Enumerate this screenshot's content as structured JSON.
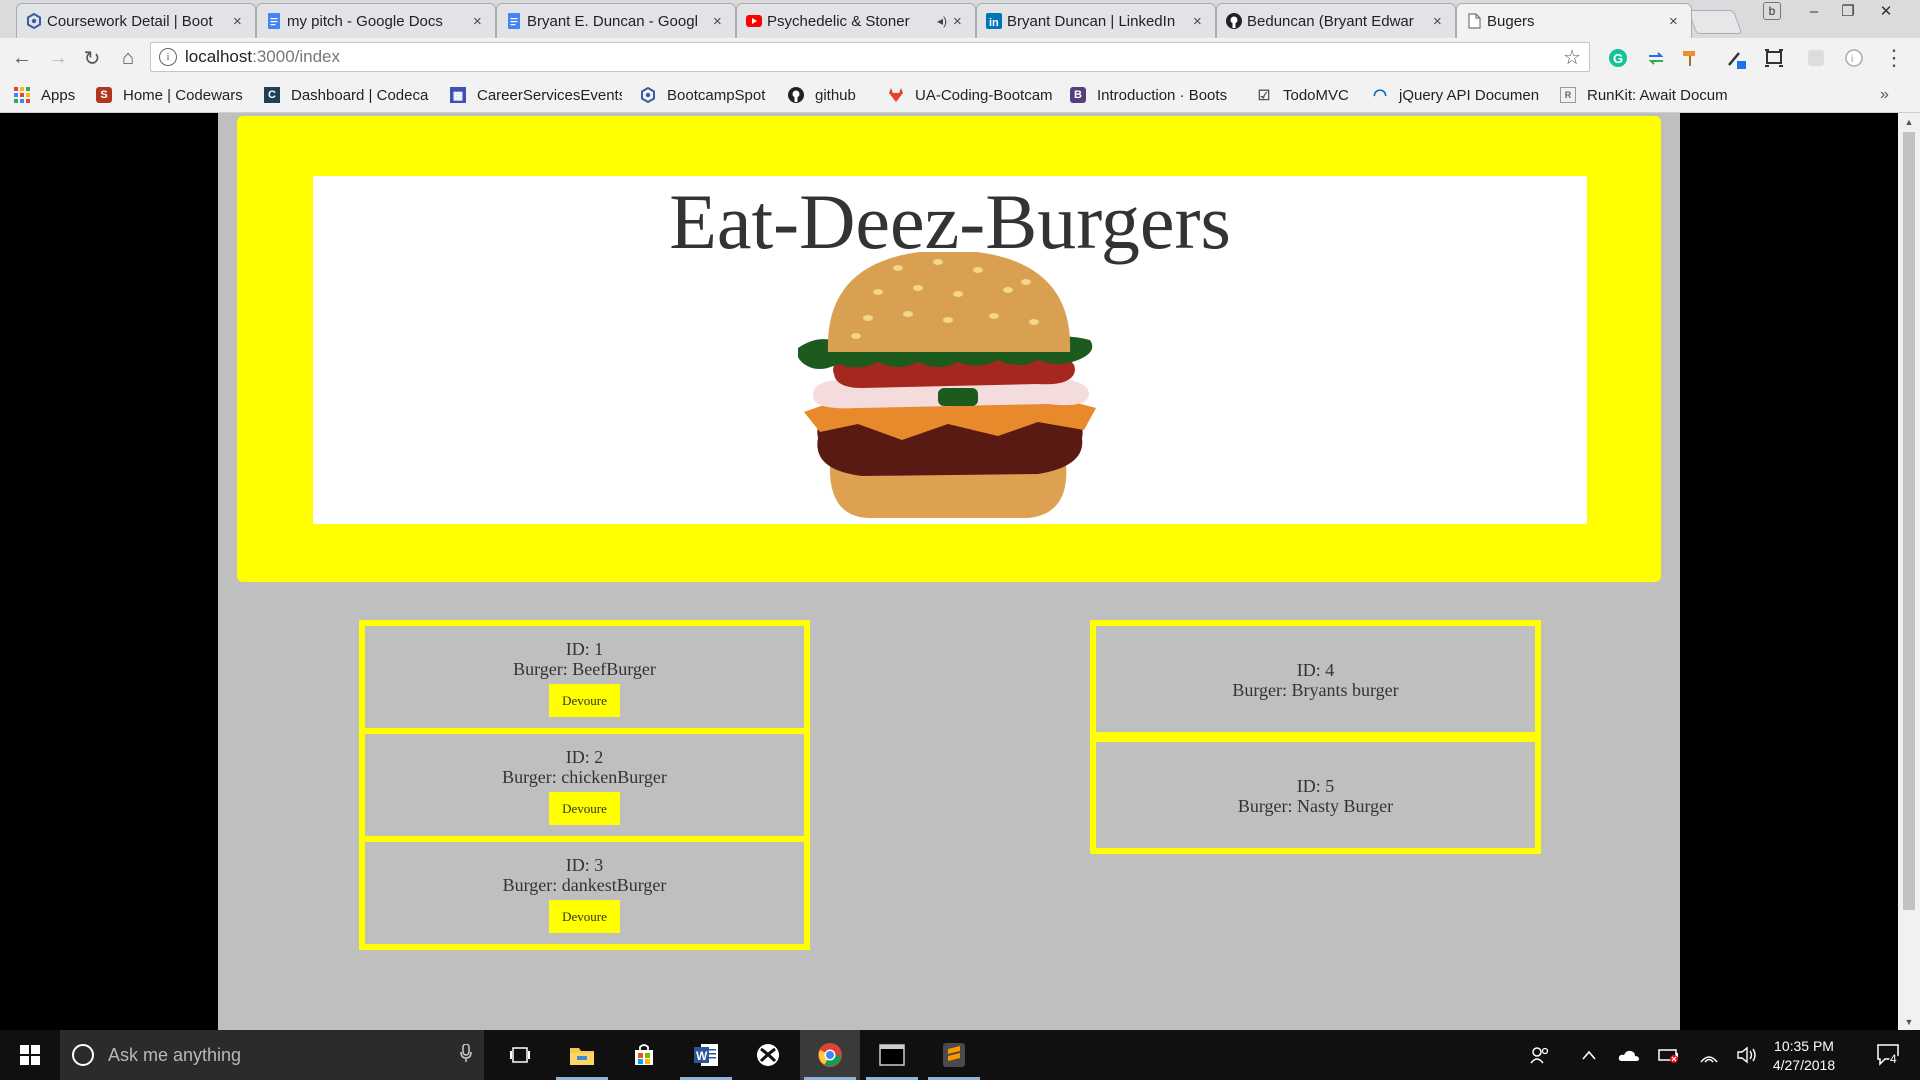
{
  "tabs": [
    {
      "label": "Coursework Detail | Boot",
      "icon": "bootcampspot-icon",
      "color": "#3b5ba5"
    },
    {
      "label": "my pitch - Google Docs",
      "icon": "google-docs-icon",
      "color": "#4285f4"
    },
    {
      "label": "Bryant E. Duncan - Googl",
      "icon": "google-docs-icon",
      "color": "#4285f4"
    },
    {
      "label": "Psychedelic & Stoner",
      "icon": "youtube-icon",
      "color": "#ff0000",
      "audio": "◂)"
    },
    {
      "label": "Bryant Duncan | LinkedIn",
      "icon": "linkedin-icon",
      "color": "#0077b5"
    },
    {
      "label": "Beduncan (Bryant Edwar",
      "icon": "github-icon",
      "color": "#222222"
    },
    {
      "label": "Bugers",
      "icon": "page-icon",
      "color": "#777777",
      "active": true
    }
  ],
  "tab_close": "×",
  "window_controls": {
    "profile": "b",
    "minimize": "–",
    "restore": "❐",
    "close": "✕"
  },
  "toolbar": {
    "back": "←",
    "forward": "→",
    "reload": "↻",
    "home": "⌂",
    "info": "i",
    "url_host": "localhost",
    "url_path": ":3000/index",
    "star": "☆",
    "menu": "⋮"
  },
  "bookmarks": [
    {
      "label": "Apps",
      "icon": "apps-grid-icon"
    },
    {
      "label": "Home | Codewars",
      "icon": "codewars-icon",
      "color": "#b1361e"
    },
    {
      "label": "Dashboard | Codeca",
      "icon": "codecademy-icon",
      "color": "#1f4056"
    },
    {
      "label": "CareerServicesEvents",
      "icon": "calendar-icon",
      "color": "#3f51b5"
    },
    {
      "label": "BootcampSpot",
      "icon": "bootcampspot-icon",
      "color": "#3b5ba5"
    },
    {
      "label": "github",
      "icon": "github-icon",
      "color": "#222222"
    },
    {
      "label": "UA-Coding-Bootcam",
      "icon": "gitlab-icon",
      "color": "#e24329"
    },
    {
      "label": "Introduction · Boots",
      "icon": "bootstrap-icon",
      "color": "#563d7c"
    },
    {
      "label": "TodoMVC",
      "icon": "checkbox-icon",
      "color": "#555555"
    },
    {
      "label": "jQuery API Documen",
      "icon": "jquery-icon",
      "color": "#0769ad"
    },
    {
      "label": "RunKit: Await Docum",
      "icon": "runkit-icon",
      "color": "#888888"
    }
  ],
  "bookmarks_overflow": "»",
  "site": {
    "title": "Eat-Deez-Burgers",
    "button_label": "Devoure",
    "id_prefix": "ID: ",
    "burger_prefix": "Burger: ",
    "left_burgers": [
      {
        "id": "1",
        "name": "BeefBurger"
      },
      {
        "id": "2",
        "name": "chickenBurger"
      },
      {
        "id": "3",
        "name": "dankestBurger"
      }
    ],
    "right_burgers": [
      {
        "id": "4",
        "name": "Bryants burger"
      },
      {
        "id": "5",
        "name": "Nasty Burger"
      }
    ]
  },
  "taskbar": {
    "search_placeholder": "Ask me anything",
    "apps": [
      "task-view-icon",
      "file-explorer-icon",
      "store-icon",
      "word-icon",
      "xbox-icon",
      "chrome-icon",
      "terminal-icon",
      "sublime-text-icon"
    ],
    "time": "10:35 PM",
    "date": "4/27/2018",
    "notifications": "4"
  },
  "colors": {
    "accent": "#ffff00",
    "page_bg": "#bfbfbf",
    "text": "#333333"
  }
}
